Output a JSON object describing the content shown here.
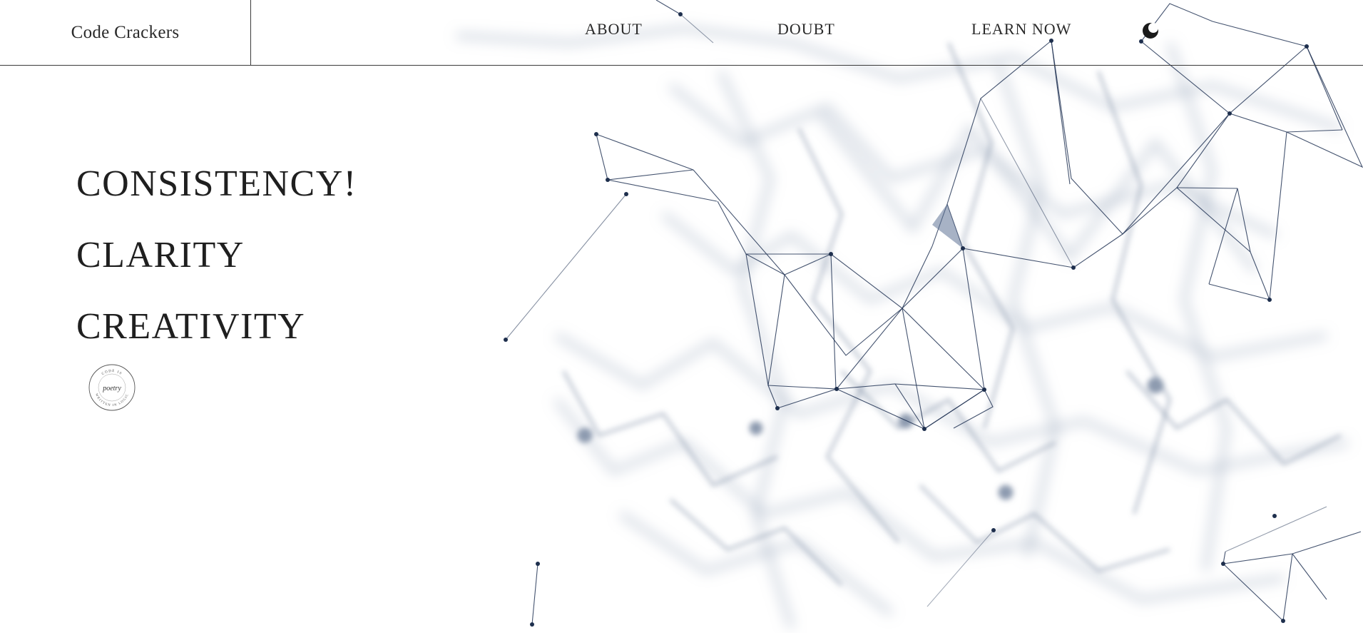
{
  "header": {
    "brand": "Code Crackers",
    "nav": [
      {
        "label": "ABOUT"
      },
      {
        "label": "DOUBT"
      },
      {
        "label": "LEARN NOW"
      }
    ],
    "theme_toggle_icon": "half-moon-icon"
  },
  "hero": {
    "lines": [
      "CONSISTENCY!",
      "CLARITY",
      "CREATIVITY"
    ],
    "stamp_icon": "code-is-poetry-seal-icon",
    "stamp_text": "CODE IS poetry WRITTEN IN LOGIC"
  },
  "colors": {
    "text": "#222222",
    "network_dark": "#1e2f4d",
    "network_light": "#b8c3d3",
    "background": "#ffffff"
  }
}
